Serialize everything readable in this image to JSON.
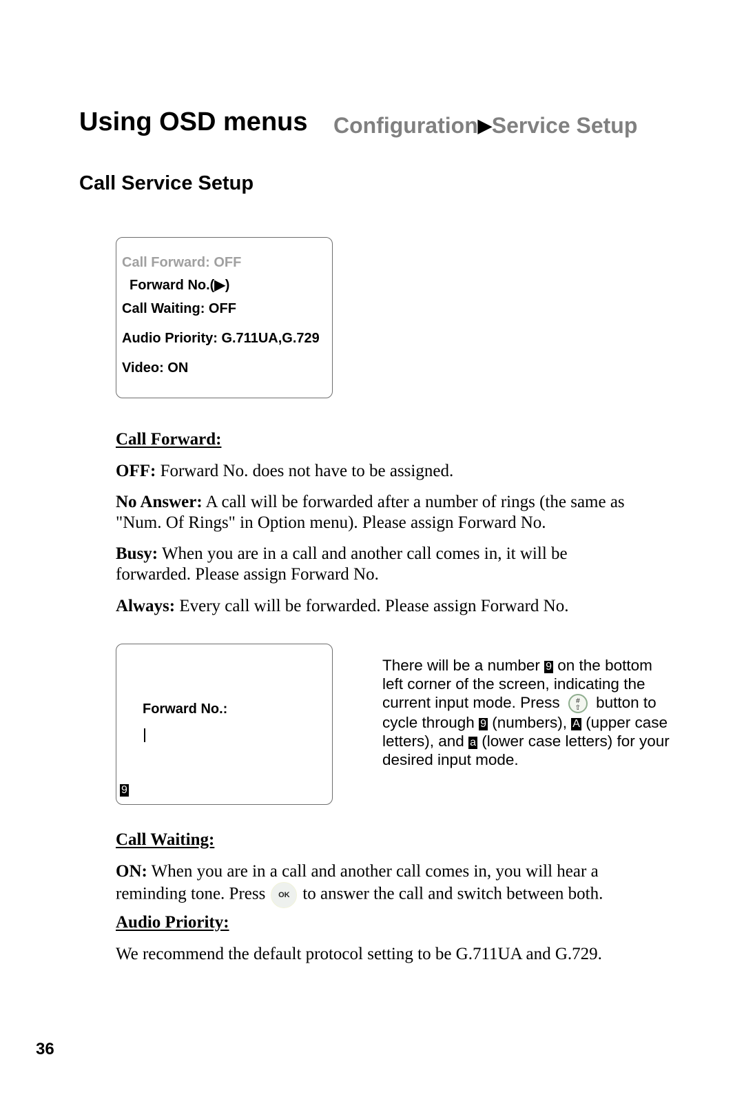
{
  "header": {
    "title": "Using OSD menus",
    "breadcrumb": {
      "parent": "Configuration",
      "separator": "▶",
      "current": "Service Setup"
    }
  },
  "section_title": "Call Service Setup",
  "osd_menu": {
    "items": [
      {
        "label": "Call Forward: OFF",
        "state": "disabled"
      },
      {
        "label": "Forward No.(▶)",
        "state": "normal"
      },
      {
        "label": "Call Waiting: OFF",
        "state": "normal"
      },
      {
        "label": "Audio Priority: G.711UA,G.729",
        "state": "normal"
      },
      {
        "label": "Video: ON",
        "state": "normal"
      }
    ]
  },
  "call_forward": {
    "heading": "Call Forward:",
    "options": [
      {
        "term": "OFF:",
        "desc": " Forward No. does not have to be assigned."
      },
      {
        "term": "No Answer:",
        "desc": " A call will be forwarded after a number of rings (the same as \"Num. Of Rings\" in Option menu). Please assign Forward No."
      },
      {
        "term": "Busy:",
        "desc": " When you are in a call and another call comes in, it will be forwarded. Please assign Forward No."
      },
      {
        "term": "Always:",
        "desc": " Every call will be forwarded. Please assign Forward No."
      }
    ]
  },
  "forward_screen": {
    "label": "Forward No.:",
    "input_value": "",
    "mode_indicator": "9"
  },
  "side_note": {
    "part1": "There will be a number ",
    "badge_number": "9",
    "part2": " on the bottom left corner of the screen, indicating the current input mode. Press ",
    "hash_button": {
      "symbol": "#",
      "sub": "⇧"
    },
    "part3": " button to cycle through ",
    "part4": " (numbers), ",
    "badge_upper": "A",
    "part5": " (upper case letters), and ",
    "badge_lower": "a",
    "part6": " (lower case letters) for your desired input mode."
  },
  "call_waiting": {
    "heading": "Call Waiting:",
    "term": "ON:",
    "desc1": " When you are in a call and another call comes in, you will hear a reminding tone. Press",
    "ok_label": "OK",
    "desc2": "to answer the call and switch between both."
  },
  "audio_priority": {
    "heading": "Audio Priority:",
    "text": "We recommend the default protocol setting to be G.711UA and G.729."
  },
  "page_number": "36"
}
